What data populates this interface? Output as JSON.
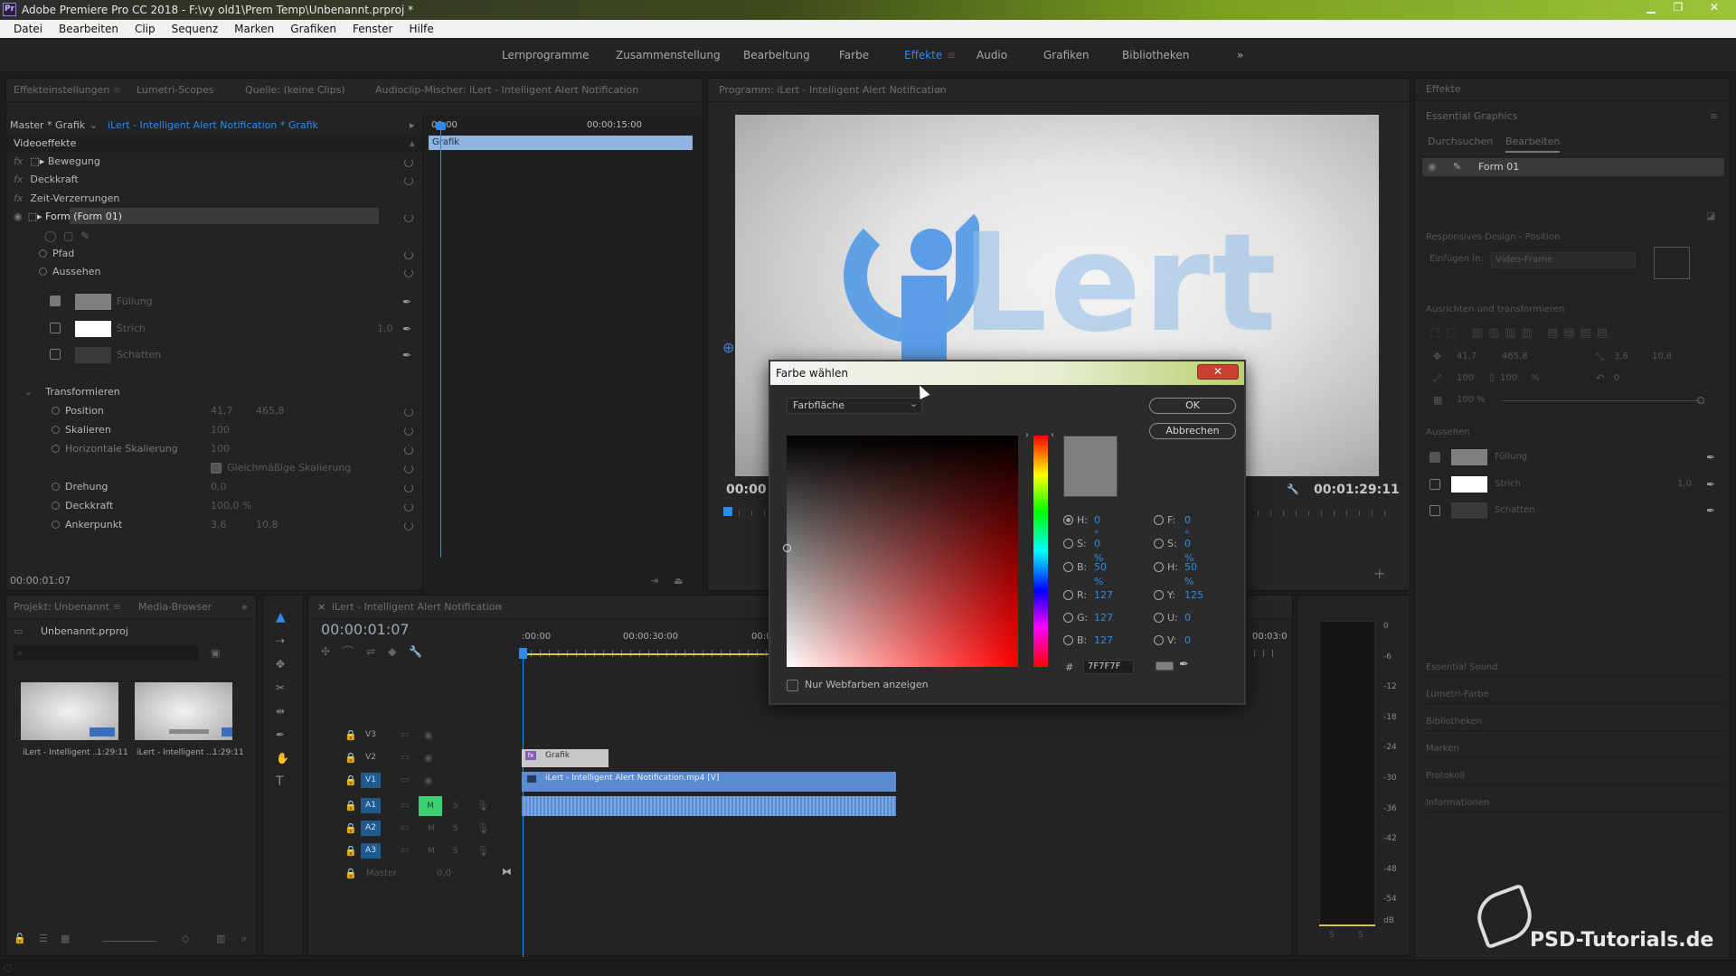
{
  "app": {
    "title": "Adobe Premiere Pro CC 2018 - F:\\vy old1\\Prem Temp\\Unbenannt.prproj *",
    "icon": "Pr"
  },
  "menu": [
    "Datei",
    "Bearbeiten",
    "Clip",
    "Sequenz",
    "Marken",
    "Grafiken",
    "Fenster",
    "Hilfe"
  ],
  "workspaces": [
    "Lernprogramme",
    "Zusammenstellung",
    "Bearbeitung",
    "Farbe",
    "Effekte",
    "Audio",
    "Grafiken",
    "Bibliotheken"
  ],
  "active_workspace": "Effekte",
  "effect_controls": {
    "tabs": [
      "Effekteinstellungen",
      "Lumetri-Scopes",
      "Quelle: (keine Clips)",
      "Audioclip-Mischer: iLert - Intelligent Alert Notification"
    ],
    "master_label": "Master * Grafik",
    "clip_label": "iLert - Intelligent Alert Notification * Grafik",
    "section": "Videoeffekte",
    "timecode_start": "00:00",
    "timecode_mid": "00:00:15:00",
    "clip_name": "Grafik",
    "items": {
      "bewegung": "Bewegung",
      "deckkraft": "Deckkraft",
      "zeit": "Zeit-Verzerrungen",
      "form": "Form (Form 01)",
      "pfad": "Pfad",
      "aussehen": "Aussehen",
      "fuellung": "Füllung",
      "strich": "Strich",
      "strich_val": "1,0",
      "schatten": "Schatten",
      "transformieren": "Transformieren",
      "position": "Position",
      "position_x": "41,7",
      "position_y": "465,8",
      "skalieren": "Skalieren",
      "skalieren_val": "100",
      "h_skal": "Horizontale Skalierung",
      "h_skal_val": "100",
      "gleich": "Gleichmäßige Skalierung",
      "drehung": "Drehung",
      "drehung_val": "0,0",
      "deckkraft2": "Deckkraft",
      "deckkraft2_val": "100,0 %",
      "anker": "Ankerpunkt",
      "anker_x": "3,6",
      "anker_y": "10,8"
    },
    "current_time": "00:00:01:07"
  },
  "program": {
    "title": "Programm: iLert - Intelligent Alert Notification",
    "timecode_left": "00:00",
    "timecode_right": "00:01:29:11",
    "logo_text": "Lert"
  },
  "essential_graphics": {
    "header": "Effekte",
    "title": "Essential Graphics",
    "tab1": "Durchsuchen",
    "tab2": "Bearbeiten",
    "layer": "Form 01",
    "responsive": "Responsives Design - Position",
    "pin_label": "Einfügen in:",
    "pin_value": "Video-Frame",
    "align": "Ausrichten und transformieren",
    "pos_x": "41,7",
    "pos_y": "465,8",
    "anchor_x": "3,6",
    "anchor_y": "10,8",
    "scale_w": "100",
    "scale_h": "100",
    "scale_unit": "%",
    "rot": "0",
    "opacity": "100 %",
    "aussehen": "Aussehen",
    "fuellung": "Füllung",
    "strich": "Strich",
    "strich_val": "1,0",
    "schatten": "Schatten",
    "panels": [
      "Essential Sound",
      "Lumetri-Farbe",
      "Bibliotheken",
      "Marken",
      "Protokoll",
      "Informationen"
    ]
  },
  "project": {
    "tabs": [
      "Projekt: Unbenannt",
      "Media-Browser"
    ],
    "file": "Unbenannt.prproj",
    "thumbs": [
      {
        "name": "iLert - Intelligent ...",
        "dur": "1:29:11"
      },
      {
        "name": "iLert - Intelligent ...",
        "dur": "1:29:11"
      }
    ]
  },
  "timeline": {
    "title": "iLert - Intelligent Alert Notification",
    "timecode": "00:00:01:07",
    "ruler": [
      ":00:00",
      "00:00:30:00",
      "00:0",
      "00:03:0"
    ],
    "tracks": [
      "V3",
      "V2",
      "V1",
      "A1",
      "A2",
      "A3"
    ],
    "master": "Master",
    "master_val": "0,0",
    "clip_grafik": "Grafik",
    "clip_video": "iLert - Intelligent Alert Notification.mp4 [V]",
    "m": "M",
    "s": "S"
  },
  "meter": {
    "labels": [
      "0",
      "-6",
      "-12",
      "-18",
      "-24",
      "-30",
      "-36",
      "-42",
      "-48",
      "-54",
      "dB"
    ],
    "s1": "S",
    "s2": "S"
  },
  "color_picker": {
    "title": "Farbe wählen",
    "mode": "Farbfläche",
    "ok": "OK",
    "cancel": "Abbrechen",
    "fields_left": [
      {
        "l": "H:",
        "v": "0 °"
      },
      {
        "l": "S:",
        "v": "0 %"
      },
      {
        "l": "B:",
        "v": "50 %"
      },
      {
        "l": "R:",
        "v": "127"
      },
      {
        "l": "G:",
        "v": "127"
      },
      {
        "l": "B:",
        "v": "127"
      }
    ],
    "fields_right": [
      {
        "l": "F:",
        "v": "0 °"
      },
      {
        "l": "S:",
        "v": "0 %"
      },
      {
        "l": "H:",
        "v": "50 %"
      },
      {
        "l": "Y:",
        "v": "125"
      },
      {
        "l": "U:",
        "v": "0"
      },
      {
        "l": "V:",
        "v": "0"
      }
    ],
    "hash": "#",
    "hex": "7F7F7F",
    "web_only": "Nur Webfarben anzeigen",
    "current_color": "#7f7f7f"
  },
  "watermark": "PSD-Tutorials.de",
  "colors": {
    "accent": "#2d8ceb",
    "panel": "#232323",
    "clip": "#5b8bd0"
  }
}
